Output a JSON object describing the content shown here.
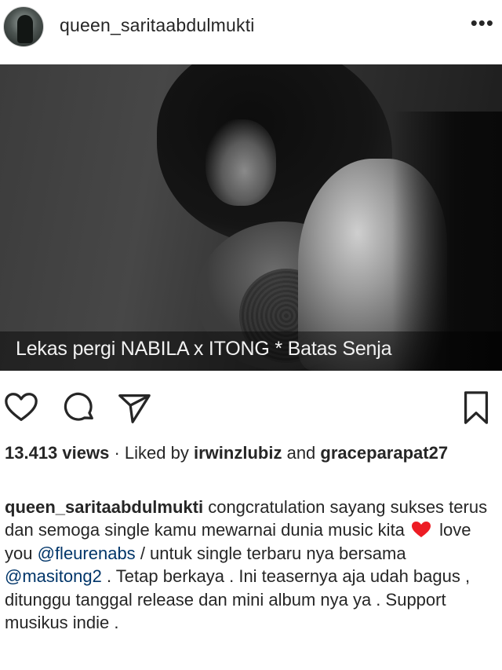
{
  "post": {
    "username": "queen_saritaabdulmukti",
    "more_icon": "•••",
    "media_caption": "Lekas pergi NABILA x ITONG * Batas Senja"
  },
  "stats": {
    "views": "13.413 views",
    "separator": "·",
    "liked_by_prefix": "Liked by",
    "liked_by_user": "irwinzlubiz",
    "and": "and",
    "other_user": "graceparapat27"
  },
  "caption": {
    "username": "queen_saritaabdulmukti",
    "text1": "congcratulation sayang sukses terus dan semoga single kamu mewarnai dunia music kita",
    "heart_icon": "red-heart-emoji",
    "text2": "love you",
    "mention1": "@fleurenabs",
    "text3": "/ untuk single terbaru nya bersama",
    "mention2": "@masitong2",
    "text4": ". Tetap berkaya . Ini teasernya aja udah bagus , ditunggu tanggal release dan mini album nya ya . Support musikus indie ."
  },
  "colors": {
    "text": "#262626",
    "mention": "#003569",
    "heart": "#ed1c24"
  }
}
